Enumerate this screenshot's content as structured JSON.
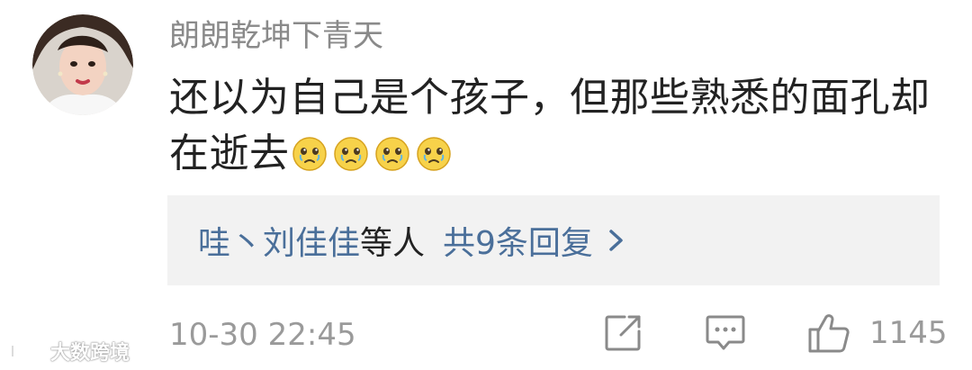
{
  "comment": {
    "username": "朗朗乾坤下青天",
    "text": "还以为自己是个孩子，但那些熟悉的面孔却在逝去",
    "emojis": [
      "sad-face-icon",
      "sad-face-icon",
      "sad-face-icon",
      "sad-face-icon"
    ],
    "timestamp": "10-30 22:45",
    "like_count": "1145"
  },
  "replies": {
    "names": "哇丶刘佳佳",
    "suffix": "等人",
    "count_label": "共9条回复",
    "chevron": "›"
  },
  "watermark": {
    "text": "大数跨境"
  },
  "colors": {
    "link": "#4a6f9a",
    "meta": "#9a9a9a",
    "reply_bg": "#f2f2f2"
  }
}
